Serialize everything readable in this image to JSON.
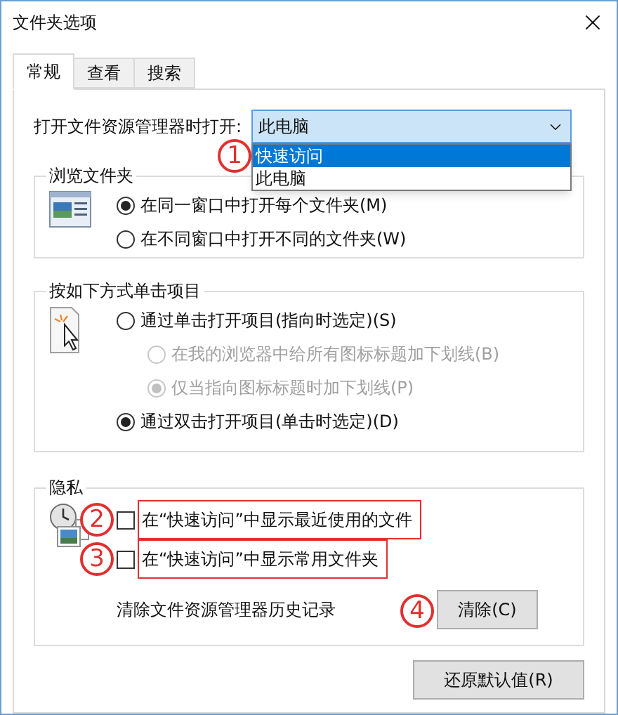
{
  "window": {
    "title": "文件夹选项"
  },
  "tabs": [
    {
      "label": "常规",
      "selected": true
    },
    {
      "label": "查看",
      "selected": false
    },
    {
      "label": "搜索",
      "selected": false
    }
  ],
  "open_with": {
    "label": "打开文件资源管理器时打开:",
    "value": "此电脑",
    "expanded": true,
    "options": [
      {
        "label": "快速访问",
        "highlighted": true,
        "marker": "1"
      },
      {
        "label": "此电脑",
        "highlighted": false
      }
    ]
  },
  "groups": [
    {
      "title": "浏览文件夹",
      "options": [
        {
          "kind": "radio",
          "label": "在同一窗口中打开每个文件夹(M)",
          "selected": true,
          "disabled": false
        },
        {
          "kind": "radio",
          "label": "在不同窗口中打开不同的文件夹(W)",
          "selected": false,
          "disabled": false
        }
      ]
    },
    {
      "title": "按如下方式单击项目",
      "options": [
        {
          "kind": "radio",
          "label": "通过单击打开项目(指向时选定)(S)",
          "selected": false,
          "disabled": false,
          "children": [
            {
              "kind": "radio",
              "label": "在我的浏览器中给所有图标标题加下划线(B)",
              "selected": false,
              "disabled": true
            },
            {
              "kind": "radio",
              "label": "仅当指向图标标题时加下划线(P)",
              "selected": true,
              "disabled": true
            }
          ]
        },
        {
          "kind": "radio",
          "label": "通过双击打开项目(单击时选定)(D)",
          "selected": true,
          "disabled": false
        }
      ]
    },
    {
      "title": "隐私",
      "options": [
        {
          "kind": "checkbox",
          "label": "在“快速访问”中显示最近使用的文件",
          "checked": false,
          "marker": "2",
          "highlighted": true
        },
        {
          "kind": "checkbox",
          "label": "在“快速访问”中显示常用文件夹",
          "checked": false,
          "marker": "3",
          "highlighted": true
        },
        {
          "kind": "action",
          "label": "清除文件资源管理器历史记录",
          "button": "清除(C)",
          "marker": "4"
        }
      ]
    }
  ],
  "restore_button": "还原默认值(R)"
}
